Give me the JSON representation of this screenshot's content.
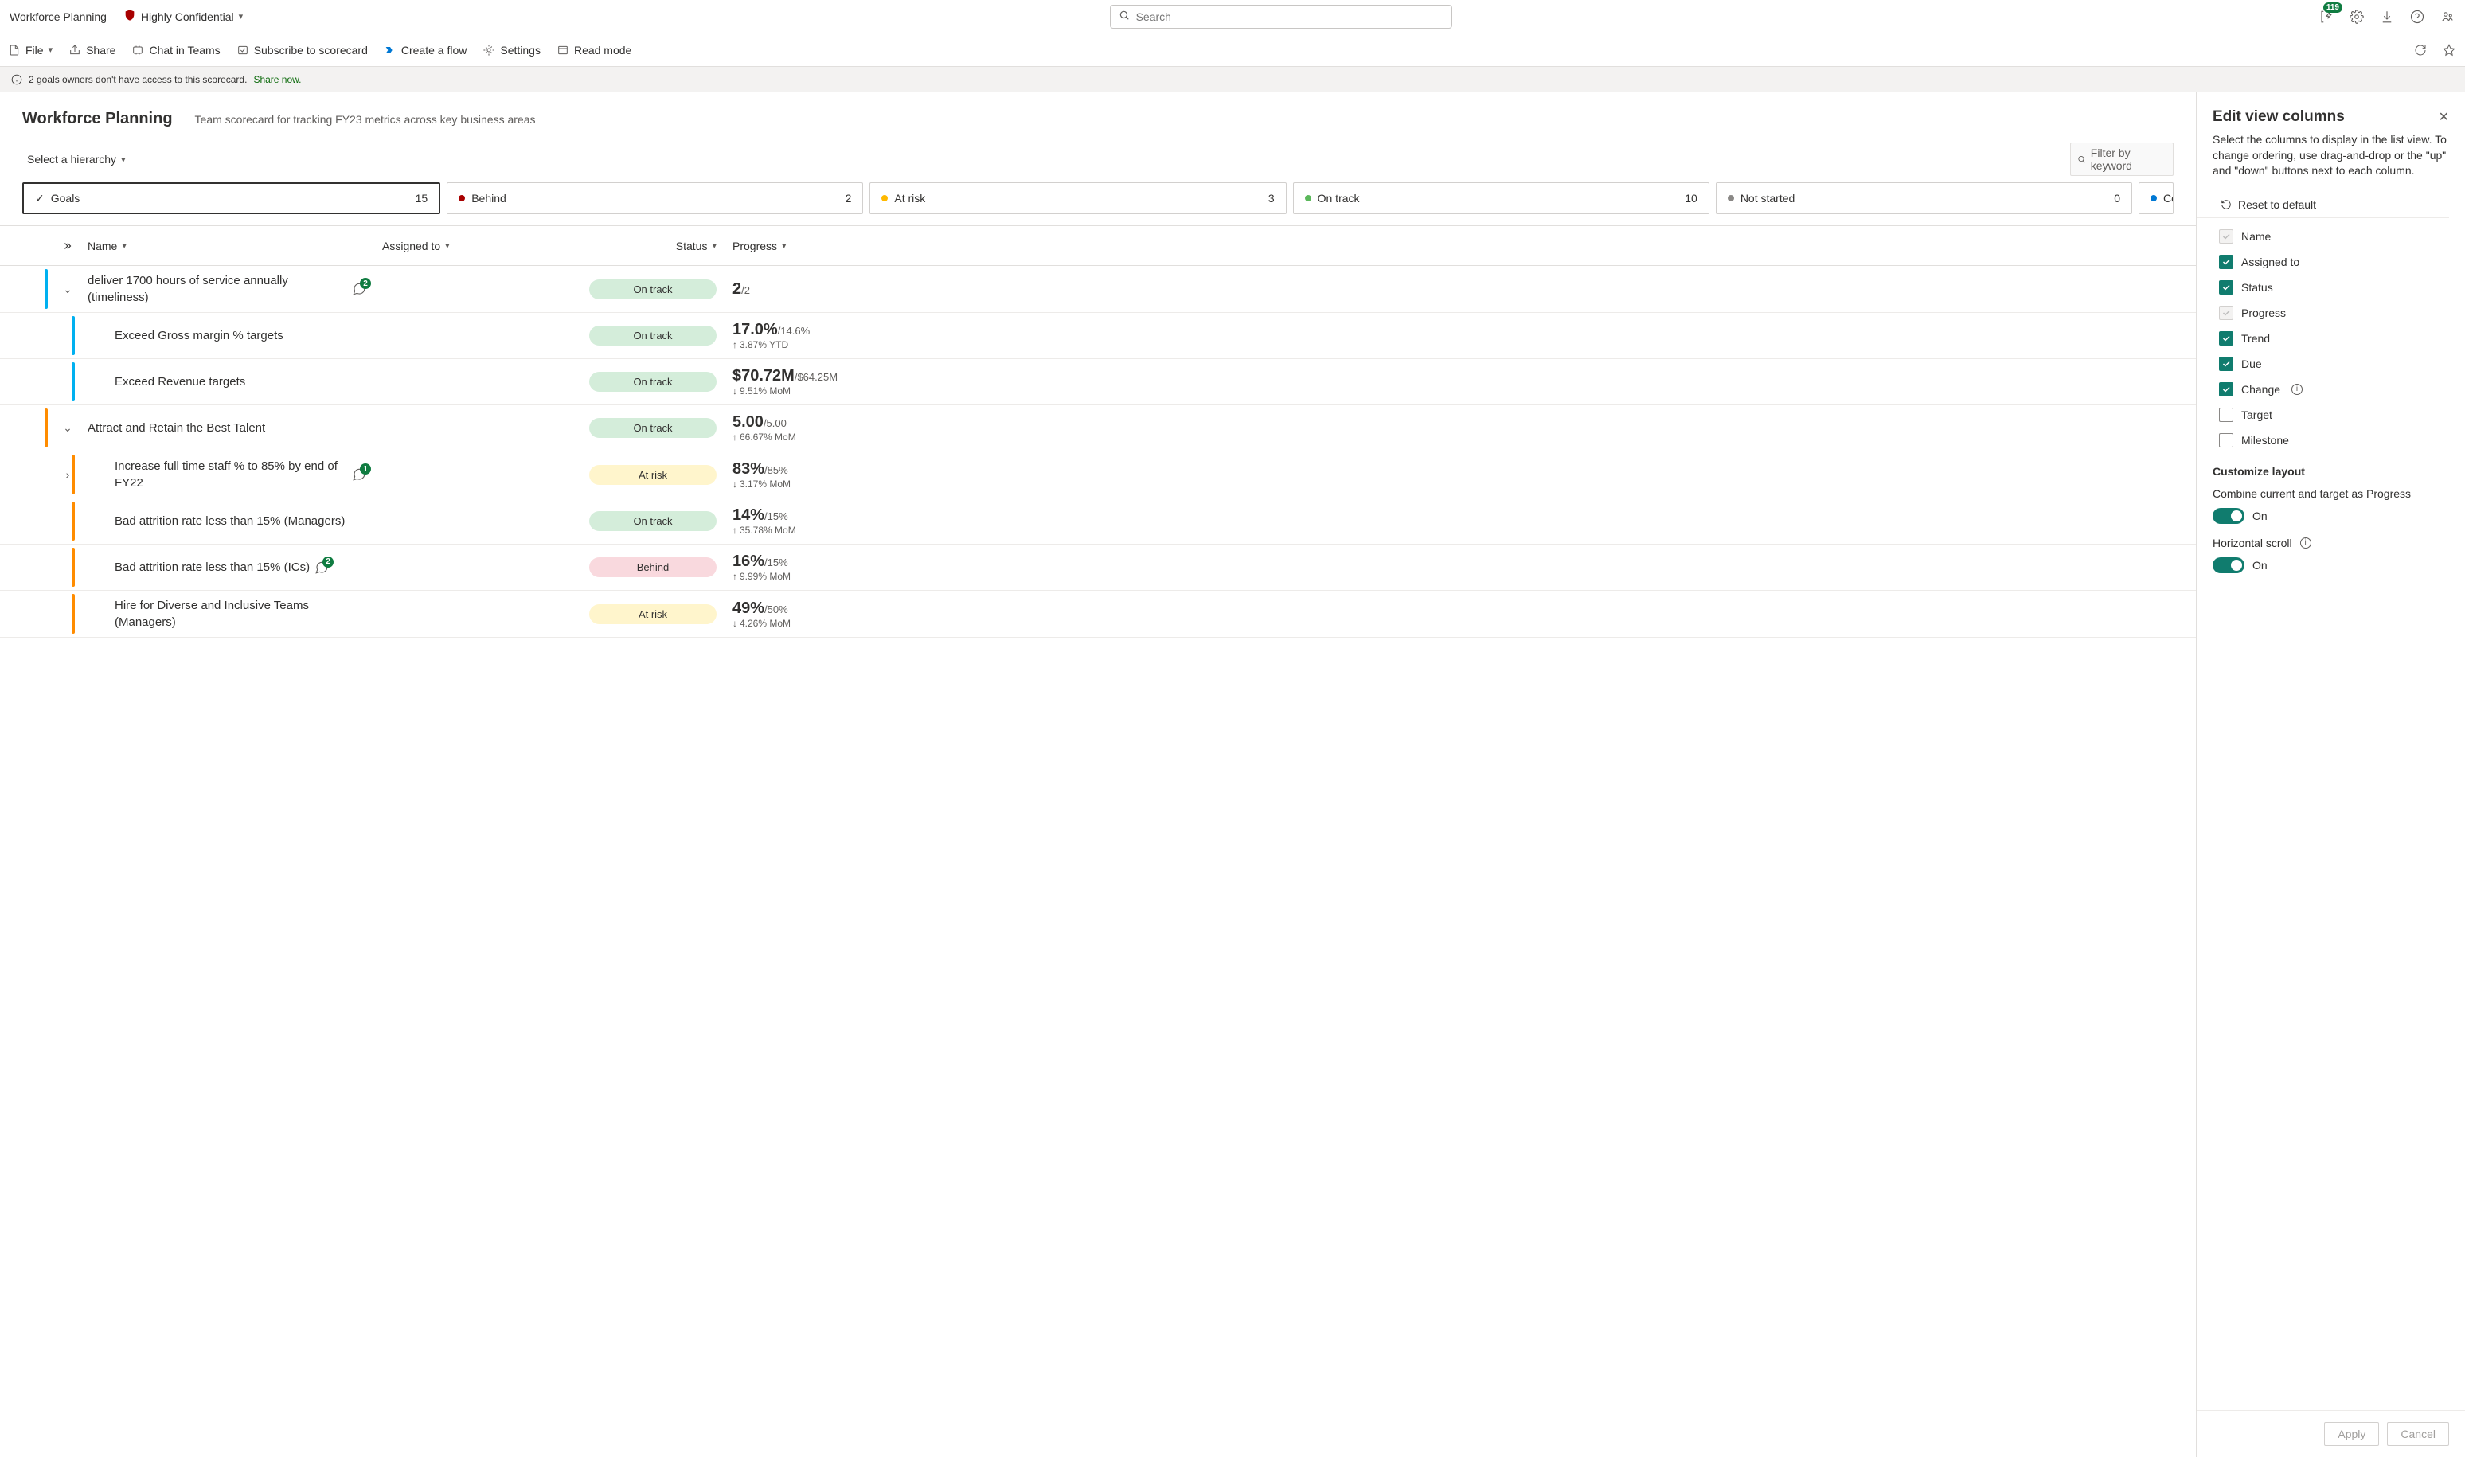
{
  "topbar": {
    "app_title": "Workforce Planning",
    "sensitivity_label": "Highly Confidential",
    "search_placeholder": "Search",
    "notification_count": "119"
  },
  "commandbar": {
    "file": "File",
    "share": "Share",
    "chat": "Chat in Teams",
    "subscribe": "Subscribe to scorecard",
    "flow": "Create a flow",
    "settings": "Settings",
    "readmode": "Read mode"
  },
  "infobar": {
    "text": "2 goals owners don't have access to this scorecard. ",
    "link": "Share now."
  },
  "header": {
    "title": "Workforce Planning",
    "subtitle": "Team scorecard for tracking FY23 metrics across key business areas",
    "hierarchy": "Select a hierarchy",
    "filter_placeholder": "Filter by keyword"
  },
  "status_cards": [
    {
      "label": "Goals",
      "count": "15",
      "type": "check",
      "active": true
    },
    {
      "label": "Behind",
      "count": "2",
      "type": "red"
    },
    {
      "label": "At risk",
      "count": "3",
      "type": "yellow"
    },
    {
      "label": "On track",
      "count": "10",
      "type": "green"
    },
    {
      "label": "Not started",
      "count": "0",
      "type": "gray"
    },
    {
      "label": "Completed",
      "count": "",
      "type": "blue",
      "cut": true
    }
  ],
  "columns": {
    "name": "Name",
    "assigned": "Assigned to",
    "status": "Status",
    "progress": "Progress"
  },
  "goals": [
    {
      "level": 0,
      "accent": "blue",
      "expand": "down",
      "name": "deliver 1700 hours of service annually (timeliness)",
      "comments": "2",
      "status": "On track",
      "status_class": "ontrack",
      "progress": "2",
      "target": "/2",
      "sub": "",
      "dir": ""
    },
    {
      "level": 1,
      "accent": "blue",
      "name": "Exceed Gross margin % targets",
      "status": "On track",
      "status_class": "ontrack",
      "progress": "17.0%",
      "target": "/14.6%",
      "sub": "3.87% YTD",
      "dir": "up"
    },
    {
      "level": 1,
      "accent": "blue",
      "name": "Exceed Revenue targets",
      "status": "On track",
      "status_class": "ontrack",
      "progress": "$70.72M",
      "target": "/$64.25M",
      "sub": "9.51% MoM",
      "dir": "down"
    },
    {
      "level": 0,
      "accent": "orange",
      "expand": "down",
      "name": "Attract and Retain the Best Talent",
      "status": "On track",
      "status_class": "ontrack",
      "progress": "5.00",
      "target": "/5.00",
      "sub": "66.67% MoM",
      "dir": "up"
    },
    {
      "level": 1,
      "accent": "orange",
      "expand": "right",
      "name": "Increase full time staff % to 85% by end of FY22",
      "comments": "1",
      "status": "At risk",
      "status_class": "atrisk",
      "progress": "83%",
      "target": "/85%",
      "sub": "3.17% MoM",
      "dir": "down"
    },
    {
      "level": 1,
      "accent": "orange",
      "name": "Bad attrition rate less than 15% (Managers)",
      "status": "On track",
      "status_class": "ontrack",
      "progress": "14%",
      "target": "/15%",
      "sub": "35.78% MoM",
      "dir": "up"
    },
    {
      "level": 1,
      "accent": "orange",
      "name": "Bad attrition rate less than 15% (ICs)",
      "comments": "2",
      "status": "Behind",
      "status_class": "behind",
      "progress": "16%",
      "target": "/15%",
      "sub": "9.99% MoM",
      "dir": "up"
    },
    {
      "level": 1,
      "accent": "orange",
      "name": "Hire for Diverse and Inclusive Teams (Managers)",
      "status": "At risk",
      "status_class": "atrisk",
      "progress": "49%",
      "target": "/50%",
      "sub": "4.26% MoM",
      "dir": "down"
    }
  ],
  "sidepanel": {
    "title": "Edit view columns",
    "desc": "Select the columns to display in the list view. To change ordering, use drag-and-drop or the \"up\" and \"down\" buttons next to each column.",
    "reset": "Reset to default",
    "columns": [
      {
        "label": "Name",
        "state": "locked"
      },
      {
        "label": "Assigned to",
        "state": "checked"
      },
      {
        "label": "Status",
        "state": "checked"
      },
      {
        "label": "Progress",
        "state": "locked"
      },
      {
        "label": "Trend",
        "state": "checked"
      },
      {
        "label": "Due",
        "state": "checked"
      },
      {
        "label": "Change",
        "state": "checked",
        "info": true
      },
      {
        "label": "Target",
        "state": "unchecked"
      },
      {
        "label": "Milestone",
        "state": "unchecked"
      }
    ],
    "customize_title": "Customize layout",
    "toggle1_label": "Combine current and target as Progress",
    "toggle1_state": "On",
    "toggle2_label": "Horizontal scroll",
    "toggle2_state": "On",
    "apply": "Apply",
    "cancel": "Cancel"
  }
}
